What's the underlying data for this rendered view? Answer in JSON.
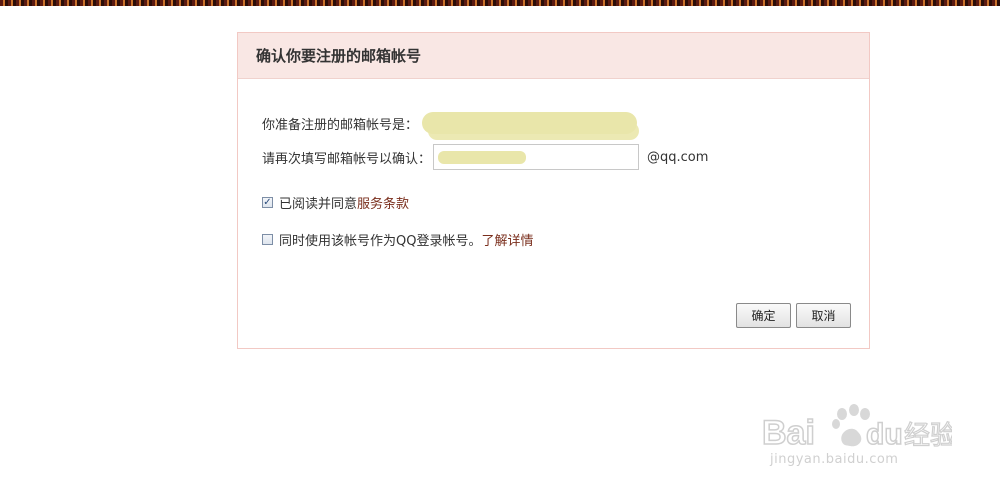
{
  "dialog": {
    "title": "确认你要注册的邮箱帐号",
    "email_label": "你准备注册的邮箱帐号是：",
    "confirm_label": "请再次填写邮箱帐号以确认：",
    "confirm_input_value": "",
    "domain_suffix": "@qq.com",
    "agree": {
      "checked": true,
      "text": "已阅读并同意",
      "link": "服务条款"
    },
    "qq_login": {
      "checked": false,
      "text": "同时使用该帐号作为QQ登录帐号。",
      "link": "了解详情"
    },
    "ok_label": "确定",
    "cancel_label": "取消"
  },
  "watermark": {
    "brand": "Baidu经验",
    "url": "jingyan.baidu.com"
  },
  "colors": {
    "header_bg": "#f9e7e4",
    "border": "#f2c9c4",
    "link": "#7a2e1c"
  }
}
